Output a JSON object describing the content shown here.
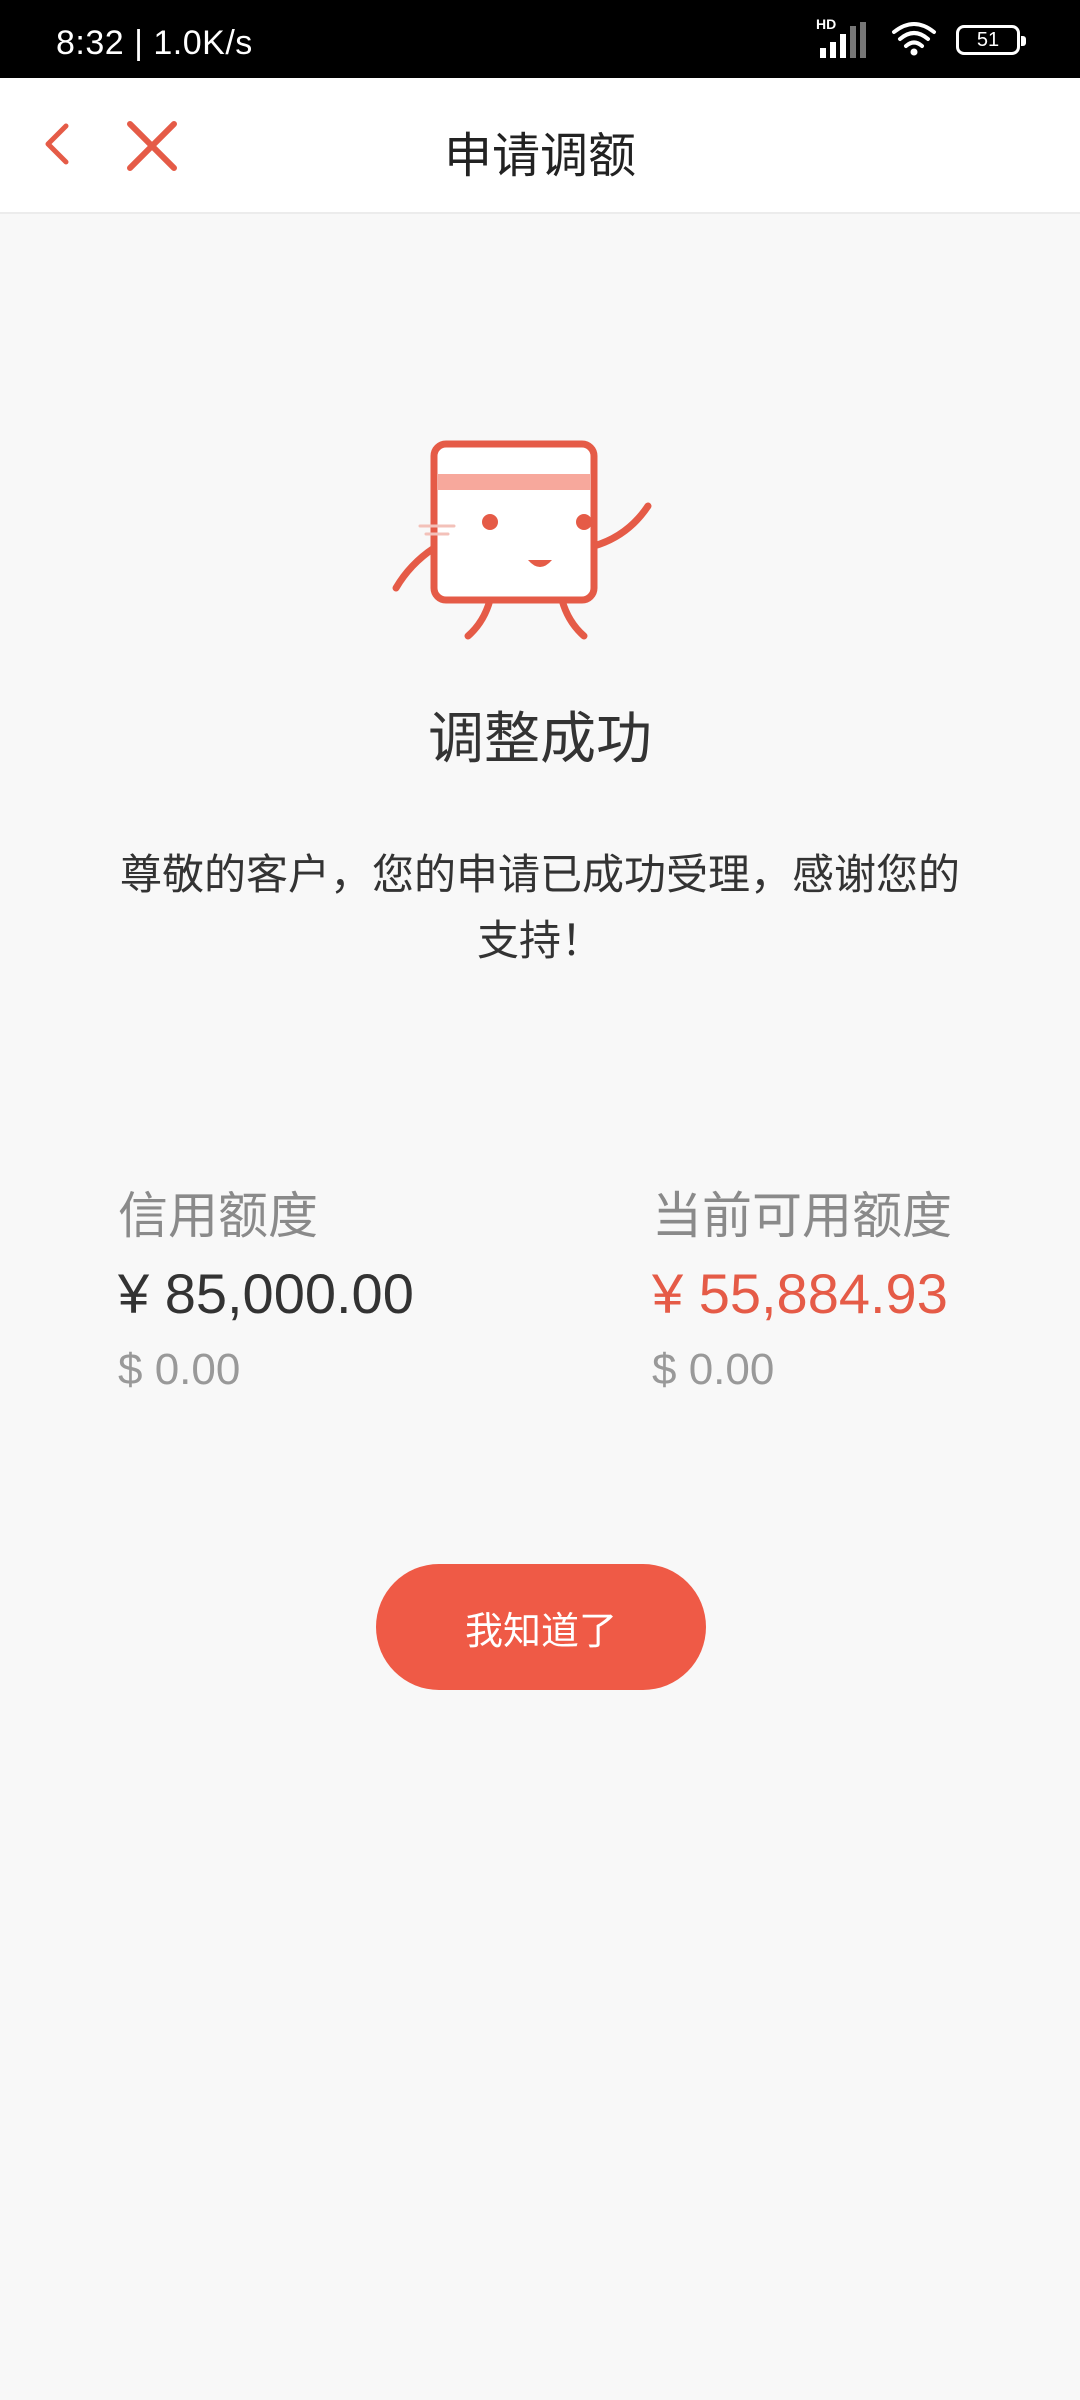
{
  "status_bar": {
    "time_speed": "8:32 | 1.0K/s",
    "network_type": "HD",
    "battery": "51"
  },
  "header": {
    "title": "申请调额",
    "back_icon": "chevron-left-icon",
    "close_icon": "close-icon"
  },
  "result": {
    "title": "调整成功",
    "message": "尊敬的客户，您的申请已成功受理，感谢您的支持！"
  },
  "amounts": {
    "credit_limit": {
      "label": "信用额度",
      "cny": "¥ 85,000.00",
      "usd": "$ 0.00"
    },
    "available_limit": {
      "label": "当前可用额度",
      "cny": "¥ 55,884.93",
      "usd": "$ 0.00"
    }
  },
  "button": {
    "label": "我知道了"
  },
  "colors": {
    "accent": "#ef5a46",
    "highlight_amount": "#e55b47",
    "background": "#f8f8f8"
  }
}
